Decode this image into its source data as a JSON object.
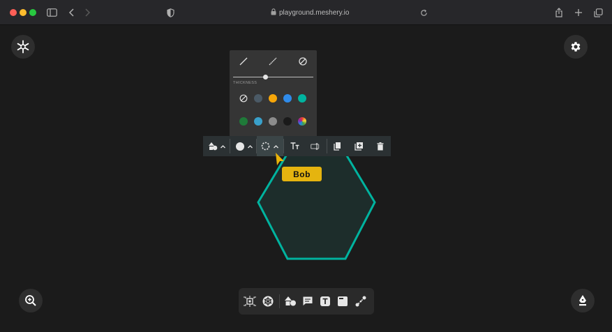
{
  "browser": {
    "url": "playground.meshery.io",
    "traffic_lights": [
      "#ff5f57",
      "#febc2e",
      "#28c840"
    ]
  },
  "panel": {
    "thickness_label": "THICKNESS",
    "thickness_value": 0.4,
    "colors_row1": [
      "none",
      "#4b5a66",
      "#f6a609",
      "#2f8bea",
      "#00b39f"
    ],
    "colors_row2": [
      "#1f7a39",
      "#39a0ca",
      "#8c8c8c",
      "#1a1a1a",
      "picker"
    ]
  },
  "tooltip": {
    "label": "Bob"
  },
  "shape": {
    "stroke": "#00b39f",
    "fill": "#1d2d2b"
  },
  "toolbar": {
    "items": [
      "shape-menu",
      "fill-color",
      "border-style",
      "text-size",
      "text-label",
      "copy",
      "duplicate",
      "delete"
    ]
  }
}
